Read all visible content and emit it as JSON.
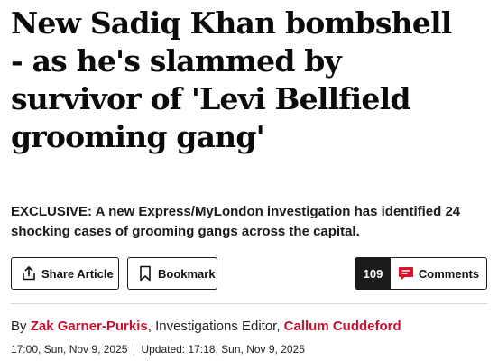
{
  "article": {
    "headline_lines": [
      "New Sadiq Khan bombshell",
      "- as he's slammed by",
      "survivor of 'Levi Bellfield",
      "grooming gang'"
    ],
    "standfirst_lines": [
      "EXCLUSIVE: A new Express/MyLondon investigation has identified 24",
      "shocking cases of grooming gangs across the capital."
    ]
  },
  "actions": {
    "share_label": "Share Article",
    "bookmark_label": "Bookmark",
    "comments_count": "109",
    "comments_label": "Comments",
    "share_icon": "share-upload-icon",
    "bookmark_icon": "bookmark-icon",
    "comments_icon": "speech-bubble-icon"
  },
  "byline": {
    "prefix": "By ",
    "author1": "Zak Garner-Purkis",
    "role1": ", Investigations Editor, ",
    "author2": "Callum Cuddeford"
  },
  "dates": {
    "published": "17:00, Sun, Nov 9, 2025",
    "updated": "Updated: 17:18, Sun, Nov 9, 2025"
  },
  "colors": {
    "author_link": "#c8102e",
    "comment_icon": "#e0102a",
    "count_bg": "#1a1a1a"
  }
}
